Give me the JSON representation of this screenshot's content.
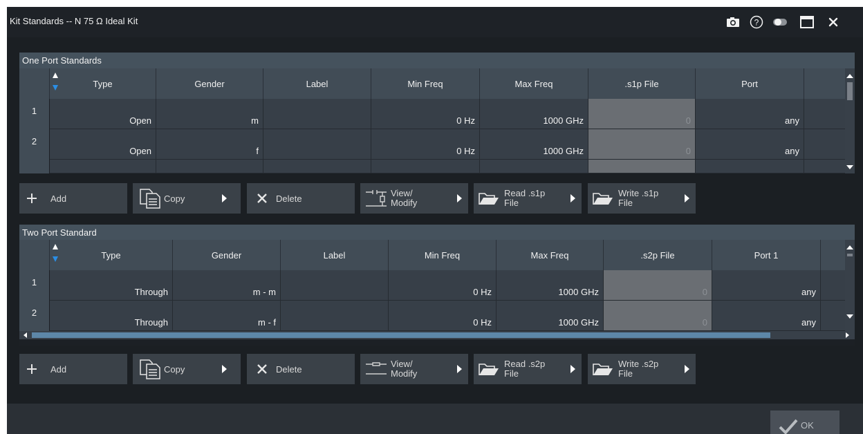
{
  "window": {
    "title": "Kit Standards -- N 75 Ω Ideal Kit",
    "icons": [
      "camera-icon",
      "help-icon",
      "toggle-icon",
      "maximize-icon",
      "close-icon"
    ]
  },
  "one_port": {
    "header": "One Port Standards",
    "columns": [
      "Type",
      "Gender",
      "Label",
      "Min Freq",
      "Max Freq",
      ".s1p File",
      "Port"
    ],
    "rows": [
      {
        "num": "1",
        "type": "Open",
        "gender": "m",
        "label": "",
        "min": "0 Hz",
        "max": "1000 GHz",
        "file": "0",
        "port": "any"
      },
      {
        "num": "2",
        "type": "Open",
        "gender": "f",
        "label": "",
        "min": "0 Hz",
        "max": "1000 GHz",
        "file": "0",
        "port": "any"
      }
    ],
    "buttons": {
      "add": "Add",
      "copy": "Copy",
      "delete": "Delete",
      "view_line1": "View/",
      "view_line2": "Modify",
      "read_line1": "Read .s1p",
      "read_line2": "File",
      "write_line1": "Write .s1p",
      "write_line2": "File"
    }
  },
  "two_port": {
    "header": "Two Port Standard",
    "columns": [
      "Type",
      "Gender",
      "Label",
      "Min Freq",
      "Max Freq",
      ".s2p File",
      "Port 1"
    ],
    "rows": [
      {
        "num": "1",
        "type": "Through",
        "gender": "m - m",
        "label": "",
        "min": "0 Hz",
        "max": "1000 GHz",
        "file": "0",
        "port": "any"
      },
      {
        "num": "2",
        "type": "Through",
        "gender": "m - f",
        "label": "",
        "min": "0 Hz",
        "max": "1000 GHz",
        "file": "0",
        "port": "any"
      }
    ],
    "buttons": {
      "add": "Add",
      "copy": "Copy",
      "delete": "Delete",
      "view_line1": "View/",
      "view_line2": "Modify",
      "read_line1": "Read .s2p",
      "read_line2": "File",
      "write_line1": "Write .s2p",
      "write_line2": "File"
    }
  },
  "footer": {
    "ok": "OK"
  },
  "colors": {
    "accent": "#2a8ee6",
    "header_bg": "#414c56",
    "cell_bg": "#373f48",
    "file_cell_bg": "#6a6e73"
  }
}
